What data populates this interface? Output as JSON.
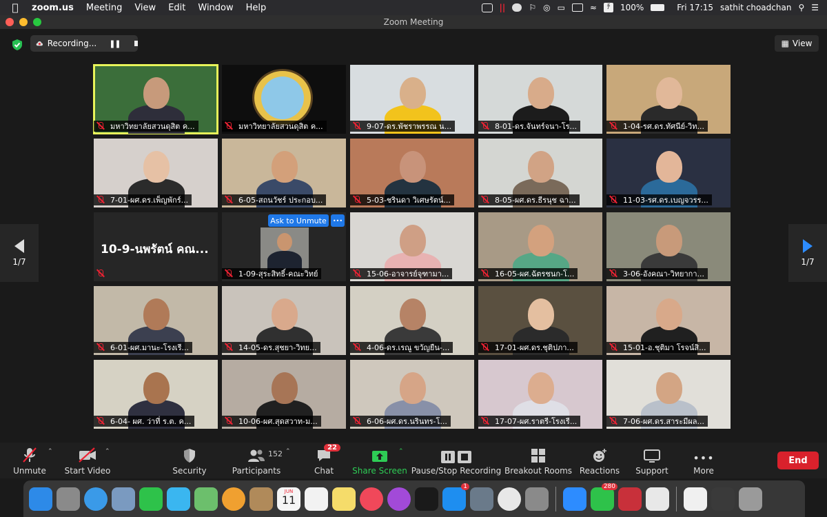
{
  "menubar": {
    "app": "zoom.us",
    "menus": [
      "Meeting",
      "View",
      "Edit",
      "Window",
      "Help"
    ],
    "battery": "100%",
    "clock": "Fri 17:15",
    "user": "sathit choadchan"
  },
  "window": {
    "title": "Zoom Meeting"
  },
  "recording": {
    "label": "Recording..."
  },
  "view_button": {
    "label": "View"
  },
  "pager": {
    "left": "1/7",
    "right": "1/7"
  },
  "participants": [
    {
      "name": "มหาวิทยาลัยสวนดุสิต ค...",
      "bg": "#3b6e3a",
      "skin": "#c79a7b",
      "shirt": "#2e2e3a",
      "active": true
    },
    {
      "name": "มหาวิทยาลัยสวนดุสิต ค...",
      "bg": "#0e0e0e",
      "logo": true
    },
    {
      "name": "9-07-ดร.พัชราพรรณ น...",
      "bg": "#d8dde0",
      "skin": "#d9b08a",
      "shirt": "#f2c31c"
    },
    {
      "name": "8-01-ดร.จันทร์จนา-โร...",
      "bg": "#d5d9d8",
      "skin": "#d8ab8a",
      "shirt": "#1c1c1c"
    },
    {
      "name": "1-04-รศ.ดร.ทัศนีย์-วิท...",
      "bg": "#c8a87a",
      "skin": "#e1b899",
      "shirt": "#2a2a2a"
    },
    {
      "name": "7-01-ผศ.ดร.เพ็ญพักร์...",
      "bg": "#d6d0cc",
      "skin": "#e6c1a5",
      "shirt": "#2b2b2b"
    },
    {
      "name": "6-05-สถนวัชร์ ประกอบ...",
      "bg": "#c9b79a",
      "skin": "#d3a07a",
      "shirt": "#3a4a68"
    },
    {
      "name": "5-03-ชรินดา วิเศษรัตน์...",
      "bg": "#b97a5a",
      "skin": "#c8937a",
      "shirt": "#233340"
    },
    {
      "name": "8-05-ผศ.ดร.ธีรนุช ฉา...",
      "bg": "#d4d6d2",
      "skin": "#d1a385",
      "shirt": "#7a6a5a"
    },
    {
      "name": "11-03-รศ.ดร.เบญจวรร...",
      "bg": "#2a3042",
      "skin": "#e3b699",
      "shirt": "#2b6a9a"
    },
    {
      "name": "10-9-นพรัตน์ คณ...",
      "bg": "#262626",
      "bigname": true
    },
    {
      "name": "1-09-สุระสิทธิ์-คณะวิทย์",
      "bg": "#262626",
      "skin": "#c9956f",
      "shirt": "#1d2330",
      "small": true,
      "ask": "Ask to Unmute"
    },
    {
      "name": "15-06-อาจารย์จุฑามา...",
      "bg": "#d9d7d3",
      "skin": "#cf9f85",
      "shirt": "#e8b2b2"
    },
    {
      "name": "16-05-ผศ.ฉัตรชนก-โ...",
      "bg": "#a89a86",
      "skin": "#d3a17e",
      "shirt": "#56a786"
    },
    {
      "name": "3-06-อังคณา-วิทยากา...",
      "bg": "#8a8a7a",
      "skin": "#c89a7a",
      "shirt": "#3a3a3a"
    },
    {
      "name": "6-01-ผศ.มานะ-โรงเรี...",
      "bg": "#c2b9a8",
      "skin": "#b07a58",
      "shirt": "#3c4050"
    },
    {
      "name": "14-05-ดร.สุชยา-วิทย...",
      "bg": "#c9c3bb",
      "skin": "#d9a98c",
      "shirt": "#303030"
    },
    {
      "name": "4-06-ดร.เรณู ขวัญยืน-...",
      "bg": "#d4d0c4",
      "skin": "#b68366",
      "shirt": "#3a3a3a"
    },
    {
      "name": "17-01-ผศ.ดร.ชุติปภา...",
      "bg": "#5a5040",
      "skin": "#e4bfa0",
      "shirt": "#2b2b2b"
    },
    {
      "name": "15-01-อ.ชุติมา โรจน์สิ...",
      "bg": "#c7b6a6",
      "skin": "#d8a98a",
      "shirt": "#202020"
    },
    {
      "name": "6-04- ผศ. ว่าที่ ร.ต. ค...",
      "bg": "#d6d2c4",
      "skin": "#a9744f",
      "shirt": "#2f3040"
    },
    {
      "name": "10-06-ผศ.สุดสวาท-ม...",
      "bg": "#b6aca2",
      "skin": "#a77556",
      "shirt": "#202020"
    },
    {
      "name": "6-06-ผศ.ดร.นรินทร-โ...",
      "bg": "#cfc8bd",
      "skin": "#d6a587",
      "shirt": "#8890a8"
    },
    {
      "name": "17-07-ผศ.ราตรี-โรงเรี...",
      "bg": "#d7c8cf",
      "skin": "#dcad8f",
      "shirt": "#dfdfe6"
    },
    {
      "name": "7-06-ผศ.ดร.สาระมีผล...",
      "bg": "#e1dfd9",
      "skin": "#d3a584",
      "shirt": "#b9c0ca"
    }
  ],
  "toolbar": {
    "unmute": "Unmute",
    "start_video": "Start Video",
    "security": "Security",
    "participants": "Participants",
    "participants_count": "152",
    "chat": "Chat",
    "chat_badge": "22",
    "share_screen": "Share Screen",
    "pause_stop": "Pause/Stop Recording",
    "breakout": "Breakout Rooms",
    "reactions": "Reactions",
    "support": "Support",
    "more": "More",
    "end": "End"
  },
  "dock": {
    "apps": [
      {
        "name": "finder-icon",
        "color": "#2d8ae8"
      },
      {
        "name": "launchpad-icon",
        "color": "#8a8a8a"
      },
      {
        "name": "safari-icon",
        "color": "#3a9ae8"
      },
      {
        "name": "preview-icon",
        "color": "#7a9ac0"
      },
      {
        "name": "facetime-icon",
        "color": "#2ec24a"
      },
      {
        "name": "messages-icon",
        "color": "#3ab6f0"
      },
      {
        "name": "maps-icon",
        "color": "#6cbf6c"
      },
      {
        "name": "photos-icon",
        "color": "#f0a030"
      },
      {
        "name": "contacts-icon",
        "color": "#b08a5a"
      },
      {
        "name": "calendar-icon",
        "color": "#f5f5f5"
      },
      {
        "name": "reminders-icon",
        "color": "#f2f2f2"
      },
      {
        "name": "notes-icon",
        "color": "#f5dc6a"
      },
      {
        "name": "music-icon",
        "color": "#f0485a"
      },
      {
        "name": "podcasts-icon",
        "color": "#a24ad8"
      },
      {
        "name": "tv-icon",
        "color": "#1a1a1a"
      },
      {
        "name": "app-store-icon",
        "color": "#1e8ef0",
        "badge": "1"
      },
      {
        "name": "screenshot-icon",
        "color": "#6a7a8a"
      },
      {
        "name": "chrome-icon",
        "color": "#e8e8e8"
      },
      {
        "name": "system-preferences-icon",
        "color": "#8a8a8a"
      },
      {
        "name": "zoom-icon",
        "color": "#2d8cff"
      },
      {
        "name": "line-icon",
        "color": "#2ec24a",
        "badge": "280"
      },
      {
        "name": "parallels-icon",
        "color": "#c8303a"
      },
      {
        "name": "textedit-icon",
        "color": "#e8e8e8"
      },
      {
        "name": "document-icon",
        "color": "#f0f0f0"
      },
      {
        "name": "activity-icon",
        "color": "#3a3a3a"
      },
      {
        "name": "trash-icon",
        "color": "#9a9a9a"
      }
    ],
    "calendar_month": "JUN",
    "calendar_day": "11"
  }
}
